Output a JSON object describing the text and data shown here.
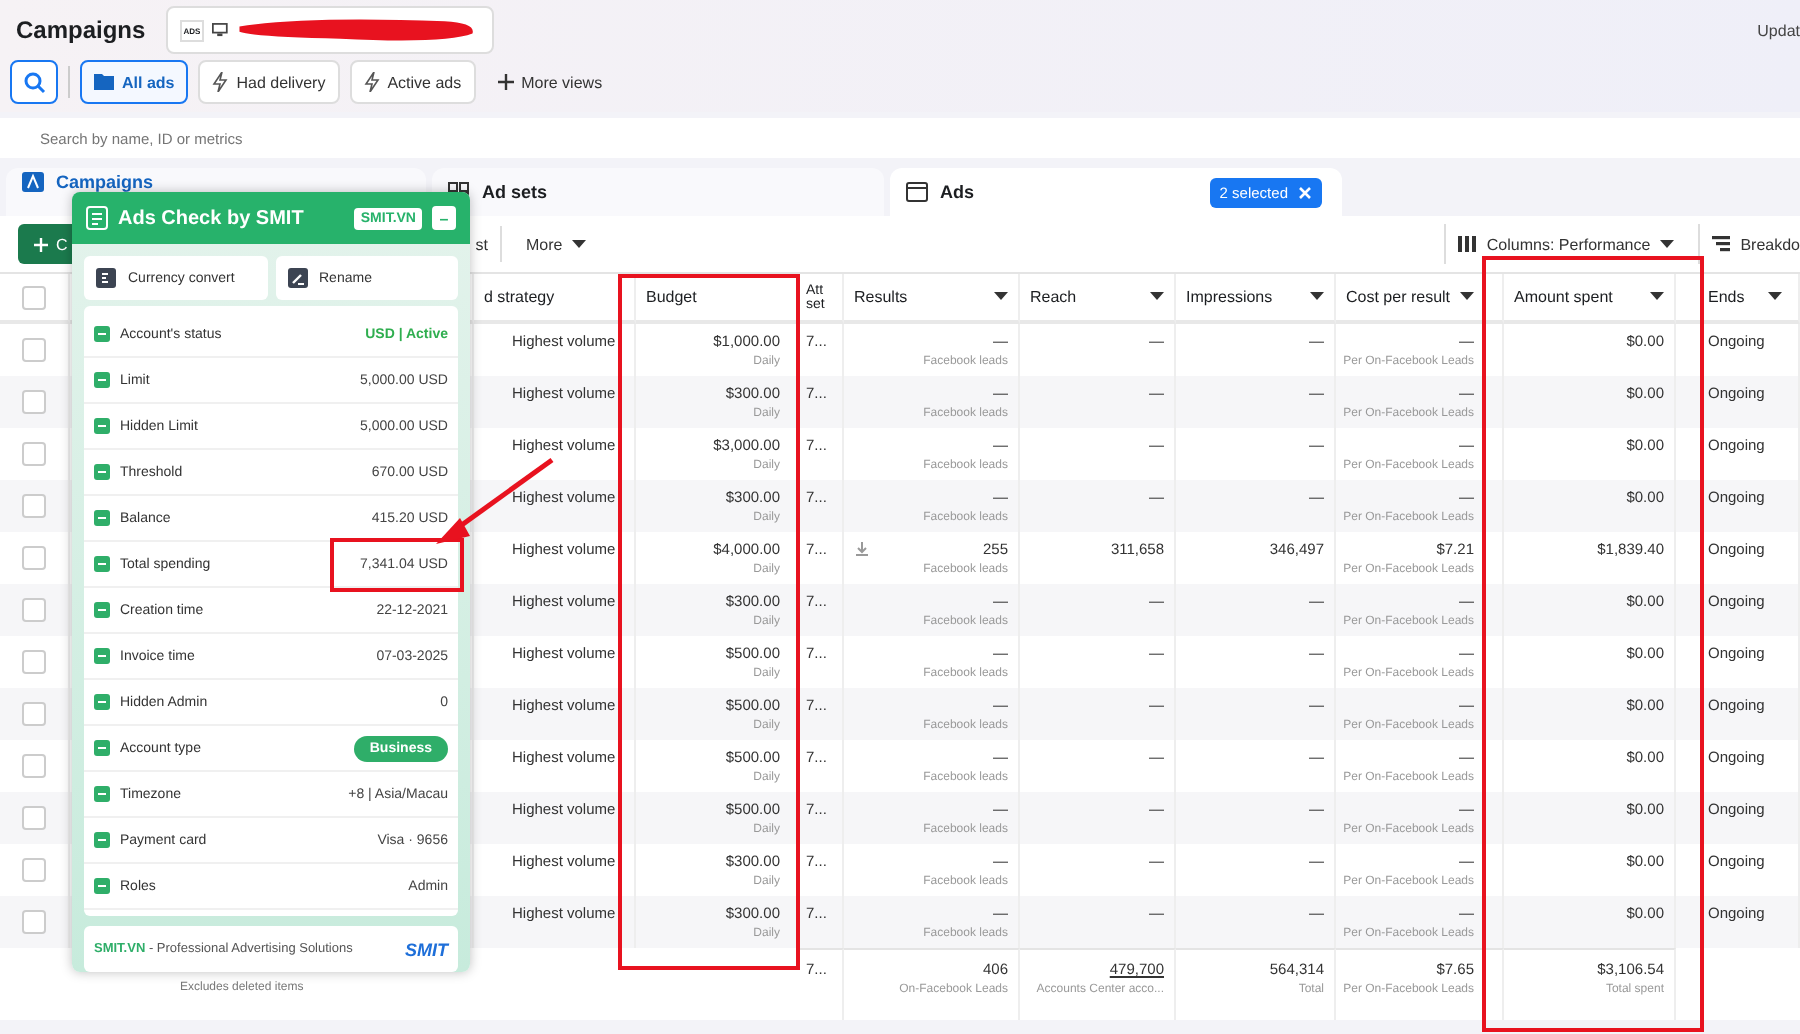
{
  "header": {
    "title": "Campaigns",
    "account_badge": "ADS",
    "update_text": "Updat"
  },
  "views": [
    {
      "label": "All ads",
      "selected": true,
      "kind": "folder"
    },
    {
      "label": "Had delivery",
      "selected": false,
      "kind": "bolt"
    },
    {
      "label": "Active ads",
      "selected": false,
      "kind": "bolt"
    },
    {
      "label": "More views",
      "selected": false,
      "kind": "plus"
    }
  ],
  "search": {
    "placeholder": "Search by name, ID or metrics"
  },
  "level_tabs": [
    {
      "label": "Campaigns",
      "selected": false,
      "kind": "campaign"
    },
    {
      "label": "Ad sets",
      "selected": false,
      "kind": "adset"
    },
    {
      "label": "Ads",
      "selected": true,
      "kind": "ad"
    }
  ],
  "selection_chip": "2 selected",
  "toolbar": {
    "create_label": "C",
    "fragment": "st",
    "more": "More",
    "columns": "Columns: Performance",
    "breakdown": "Breakdo"
  },
  "table": {
    "header_checked": false,
    "columns": [
      {
        "label": "d strategy",
        "menu": false
      },
      {
        "label": "Budget",
        "menu": false
      },
      {
        "label": "Att set",
        "menu": false
      },
      {
        "label": "Results",
        "menu": true
      },
      {
        "label": "Reach",
        "menu": true
      },
      {
        "label": "Impressions",
        "menu": true
      },
      {
        "label": "Cost per result",
        "menu": true
      },
      {
        "label": "Amount spent",
        "menu": true
      },
      {
        "label": "Ends",
        "menu": true
      }
    ],
    "rows": [
      {
        "checked": false,
        "strategy": "Highest volume",
        "budget": "$1,000.00",
        "budget_period": "Daily",
        "att": "7...",
        "result": "—",
        "result_label": "Facebook leads",
        "result_icon": false,
        "reach": "—",
        "impressions": "—",
        "cost": "—",
        "cost_label": "Per On-Facebook Leads",
        "spent": "$0.00",
        "ends": "Ongoing"
      },
      {
        "checked": false,
        "strategy": "Highest volume",
        "budget": "$300.00",
        "budget_period": "Daily",
        "att": "7...",
        "result": "—",
        "result_label": "Facebook leads",
        "result_icon": false,
        "reach": "—",
        "impressions": "—",
        "cost": "—",
        "cost_label": "Per On-Facebook Leads",
        "spent": "$0.00",
        "ends": "Ongoing"
      },
      {
        "checked": false,
        "strategy": "Highest volume",
        "budget": "$3,000.00",
        "budget_period": "Daily",
        "att": "7...",
        "result": "—",
        "result_label": "Facebook leads",
        "result_icon": false,
        "reach": "—",
        "impressions": "—",
        "cost": "—",
        "cost_label": "Per On-Facebook Leads",
        "spent": "$0.00",
        "ends": "Ongoing"
      },
      {
        "checked": false,
        "strategy": "Highest volume",
        "budget": "$300.00",
        "budget_period": "Daily",
        "att": "7...",
        "result": "—",
        "result_label": "Facebook leads",
        "result_icon": false,
        "reach": "—",
        "impressions": "—",
        "cost": "—",
        "cost_label": "Per On-Facebook Leads",
        "spent": "$0.00",
        "ends": "Ongoing"
      },
      {
        "checked": false,
        "strategy": "Highest volume",
        "budget": "$4,000.00",
        "budget_period": "Daily",
        "att": "7...",
        "result": "255",
        "result_label": "Facebook leads",
        "result_icon": true,
        "reach": "311,658",
        "impressions": "346,497",
        "cost": "$7.21",
        "cost_label": "Per On-Facebook Leads",
        "spent": "$1,839.40",
        "ends": "Ongoing"
      },
      {
        "checked": false,
        "strategy": "Highest volume",
        "budget": "$300.00",
        "budget_period": "Daily",
        "att": "7...",
        "result": "—",
        "result_label": "Facebook leads",
        "result_icon": false,
        "reach": "—",
        "impressions": "—",
        "cost": "—",
        "cost_label": "Per On-Facebook Leads",
        "spent": "$0.00",
        "ends": "Ongoing"
      },
      {
        "checked": false,
        "strategy": "Highest volume",
        "budget": "$500.00",
        "budget_period": "Daily",
        "att": "7...",
        "result": "—",
        "result_label": "Facebook leads",
        "result_icon": false,
        "reach": "—",
        "impressions": "—",
        "cost": "—",
        "cost_label": "Per On-Facebook Leads",
        "spent": "$0.00",
        "ends": "Ongoing"
      },
      {
        "checked": false,
        "strategy": "Highest volume",
        "budget": "$500.00",
        "budget_period": "Daily",
        "att": "7...",
        "result": "—",
        "result_label": "Facebook leads",
        "result_icon": false,
        "reach": "—",
        "impressions": "—",
        "cost": "—",
        "cost_label": "Per On-Facebook Leads",
        "spent": "$0.00",
        "ends": "Ongoing"
      },
      {
        "checked": false,
        "strategy": "Highest volume",
        "budget": "$500.00",
        "budget_period": "Daily",
        "att": "7...",
        "result": "—",
        "result_label": "Facebook leads",
        "result_icon": false,
        "reach": "—",
        "impressions": "—",
        "cost": "—",
        "cost_label": "Per On-Facebook Leads",
        "spent": "$0.00",
        "ends": "Ongoing"
      },
      {
        "checked": false,
        "strategy": "Highest volume",
        "budget": "$500.00",
        "budget_period": "Daily",
        "att": "7...",
        "result": "—",
        "result_label": "Facebook leads",
        "result_icon": false,
        "reach": "—",
        "impressions": "—",
        "cost": "—",
        "cost_label": "Per On-Facebook Leads",
        "spent": "$0.00",
        "ends": "Ongoing"
      },
      {
        "checked": false,
        "strategy": "Highest volume",
        "budget": "$300.00",
        "budget_period": "Daily",
        "att": "7...",
        "result": "—",
        "result_label": "Facebook leads",
        "result_icon": false,
        "reach": "—",
        "impressions": "—",
        "cost": "—",
        "cost_label": "Per On-Facebook Leads",
        "spent": "$0.00",
        "ends": "Ongoing"
      },
      {
        "checked": false,
        "strategy": "Highest volume",
        "budget": "$300.00",
        "budget_period": "Daily",
        "att": "7...",
        "result": "—",
        "result_label": "Facebook leads",
        "result_icon": false,
        "reach": "—",
        "impressions": "—",
        "cost": "—",
        "cost_label": "Per On-Facebook Leads",
        "spent": "$0.00",
        "ends": "Ongoing"
      }
    ],
    "footer": {
      "note": "Excludes deleted items",
      "att": "7...",
      "result": "406",
      "result_label": "On-Facebook Leads",
      "reach": "479,700",
      "reach_label": "Accounts Center acco...",
      "impressions": "564,314",
      "impressions_label": "Total",
      "cost": "$7.65",
      "cost_label": "Per On-Facebook Leads",
      "spent": "$3,106.54",
      "spent_label": "Total spent"
    }
  },
  "ads_check_panel": {
    "title": "Ads Check by SMIT",
    "site_badge": "SMIT.VN",
    "minimize": "–",
    "actions": [
      {
        "label": "Currency convert",
        "kind": "currency"
      },
      {
        "label": "Rename",
        "kind": "rename"
      }
    ],
    "rows": [
      {
        "label": "Account's status",
        "value": "USD | Active",
        "kind": "status"
      },
      {
        "label": "Limit",
        "value": "5,000.00 USD",
        "kind": "text"
      },
      {
        "label": "Hidden Limit",
        "value": "5,000.00 USD",
        "kind": "text"
      },
      {
        "label": "Threshold",
        "value": "670.00 USD",
        "kind": "text"
      },
      {
        "label": "Balance",
        "value": "415.20 USD",
        "kind": "text"
      },
      {
        "label": "Total spending",
        "value": "7,341.04 USD",
        "kind": "text"
      },
      {
        "label": "Creation time",
        "value": "22-12-2021",
        "kind": "text"
      },
      {
        "label": "Invoice time",
        "value": "07-03-2025",
        "kind": "text"
      },
      {
        "label": "Hidden Admin",
        "value": "0",
        "kind": "text"
      },
      {
        "label": "Account type",
        "value": "Business",
        "kind": "pill"
      },
      {
        "label": "Timezone",
        "value": "+8 | Asia/Macau",
        "kind": "text"
      },
      {
        "label": "Payment card",
        "value": "Visa · 9656",
        "kind": "text"
      },
      {
        "label": "Roles",
        "value": "Admin",
        "kind": "text"
      }
    ],
    "footer_site": "SMIT.VN",
    "footer_text": "- Professional Advertising Solutions",
    "logo": "SMIT"
  }
}
